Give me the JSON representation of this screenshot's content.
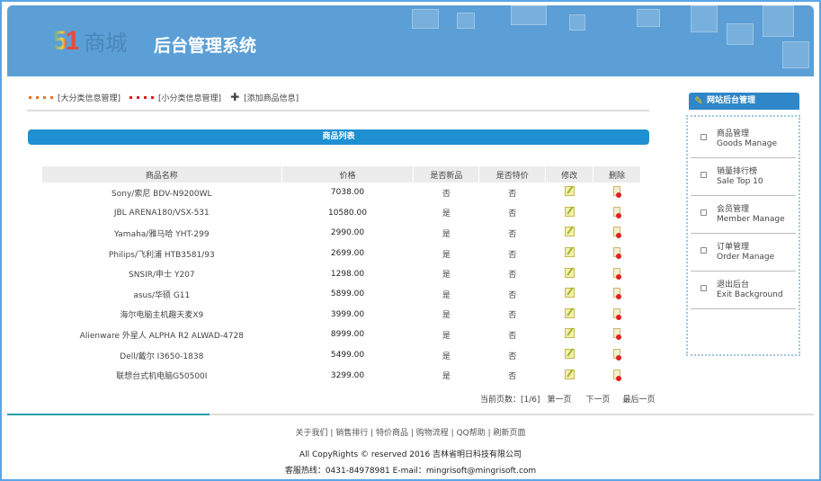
{
  "header": {
    "logo_num": "51",
    "logo_text": "商城",
    "title": "后台管理系统"
  },
  "nav": [
    {
      "label": "[大分类信息管理]",
      "icon": "grid-orange-icon"
    },
    {
      "label": "[小分类信息管理]",
      "icon": "grid-red-icon"
    },
    {
      "label": "[添加商品信息]",
      "icon": "plus-green-icon"
    }
  ],
  "list_title": "商品列表",
  "table": {
    "headers": [
      "商品名称",
      "价格",
      "是否新品",
      "是否特价",
      "修改",
      "删除"
    ],
    "rows": [
      [
        "Sony/索尼 BDV-N9200WL",
        "7038.00",
        "否",
        "否"
      ],
      [
        "JBL ARENA180/VSX-531",
        "10580.00",
        "是",
        "否"
      ],
      [
        "Yamaha/雅马哈 YHT-299",
        "2990.00",
        "是",
        "否"
      ],
      [
        "Philips/飞利浦 HTB3581/93",
        "2699.00",
        "是",
        "否"
      ],
      [
        "SNSIR/申士 Y207",
        "1298.00",
        "是",
        "否"
      ],
      [
        "asus/华硕 G11",
        "5899.00",
        "是",
        "否"
      ],
      [
        "海尔电脑主机趣天麦X9",
        "3999.00",
        "是",
        "否"
      ],
      [
        "Alienware 外星人 ALPHA R2 ALWAD-4728",
        "8999.00",
        "是",
        "否"
      ],
      [
        "Dell/戴尔 I3650-1838",
        "5499.00",
        "是",
        "否"
      ],
      [
        "联想台式机电脑G50500I",
        "3299.00",
        "是",
        "否"
      ]
    ]
  },
  "pager": {
    "current": "当前页数：[1/6]",
    "first": "第一页",
    "next": "下一页",
    "last": "最后一页"
  },
  "footer": {
    "links": [
      "关于我们",
      "销售排行",
      "特价商品",
      "购物流程",
      "QQ帮助",
      "刷新页面"
    ],
    "copyright": "All CopyRights © reserved 2016 吉林省明日科技有限公司",
    "contact": "客服热线：0431-84978981 E-mail：mingrisoft@mingrisoft.com"
  },
  "sidebar": {
    "title": "网站后台管理",
    "items": [
      {
        "cn": "商品管理",
        "en": "Goods Manage"
      },
      {
        "cn": "销量排行榜",
        "en": "Sale Top 10"
      },
      {
        "cn": "会员管理",
        "en": "Member Manage"
      },
      {
        "cn": "订单管理",
        "en": "Order Manage"
      },
      {
        "cn": "退出后台",
        "en": "Exit Background"
      }
    ]
  },
  "colors": {
    "header": "#5b9fd6",
    "accent": "#1e8fd0"
  }
}
